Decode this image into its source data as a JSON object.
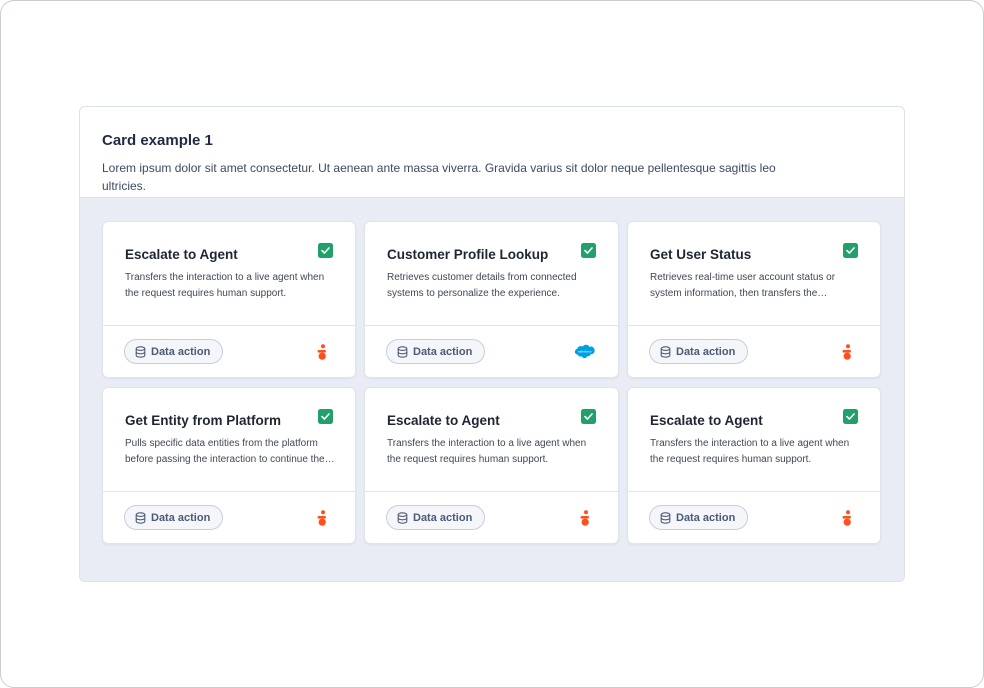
{
  "panel": {
    "title": "Card example 1",
    "description": "Lorem ipsum dolor sit amet consectetur. Ut aenean ante massa viverra. Gravida varius sit dolor neque pellentesque sagittis leo ultricies."
  },
  "cards": [
    {
      "title": "Escalate to Agent",
      "description": "Transfers the interaction to a live agent when the request requires human support.",
      "checked": true,
      "tag_label": "Data action",
      "tag_icon": "database-icon",
      "vendor_icon": "genesys-icon"
    },
    {
      "title": "Customer Profile Lookup",
      "description": "Retrieves customer details from connected systems to personalize the experience.",
      "checked": true,
      "tag_label": "Data action",
      "tag_icon": "database-icon",
      "vendor_icon": "salesforce-icon"
    },
    {
      "title": "Get User Status",
      "description": "Retrieves real-time user account status or system information, then transfers the interaction.",
      "checked": true,
      "tag_label": "Data action",
      "tag_icon": "database-icon",
      "vendor_icon": "genesys-icon"
    },
    {
      "title": "Get Entity from Platform",
      "description": "Pulls specific data entities from the platform before passing the interaction to continue the flow.",
      "checked": true,
      "tag_label": "Data action",
      "tag_icon": "database-icon",
      "vendor_icon": "genesys-icon"
    },
    {
      "title": "Escalate to Agent",
      "description": "Transfers the interaction to a live agent when the request requires human support.",
      "checked": true,
      "tag_label": "Data action",
      "tag_icon": "database-icon",
      "vendor_icon": "genesys-icon"
    },
    {
      "title": "Escalate to Agent",
      "description": "Transfers the interaction to a live agent when the request requires human support.",
      "checked": true,
      "tag_label": "Data action",
      "tag_icon": "database-icon",
      "vendor_icon": "genesys-icon"
    }
  ],
  "colors": {
    "check": "#22a06b",
    "genesys": "#ff4f1f",
    "salesforce": "#00a1e0",
    "panel_body": "#e9ecf4"
  }
}
